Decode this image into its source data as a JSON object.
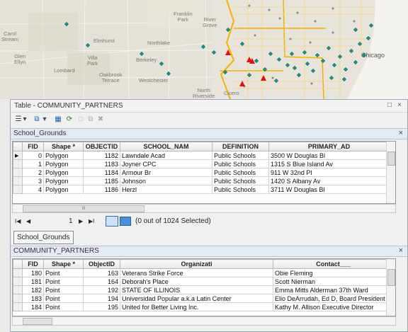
{
  "map": {
    "labels": {
      "franklin_park": "Franklin\nPark",
      "river_grove": "River\nGrove",
      "carol_stream": "Carol\nStream",
      "elmhurst": "Elmhurst",
      "northlake": "Northlake",
      "glen_ellyn": "Glen\nEllyn",
      "villa_park": "Villa\nPark",
      "berkeley": "Berkeley",
      "lombard": "Lombard",
      "oakbrook_terrace": "Oakbrook\nTerrace",
      "westchester": "Westchester",
      "north_riverside": "North\nRiverside",
      "cicero": "Cicero",
      "chicago": "Chicago"
    }
  },
  "window": {
    "title": "Table - COMMUNITY_PARTNERS",
    "restore_glyph": "□",
    "close_glyph": "×"
  },
  "toolbar": {
    "table_options": "☰",
    "dropdown": "▾",
    "related_tables": "⧉",
    "select_by_attributes": "▦",
    "switch_selection": "⟳",
    "clear_selection": "□",
    "zoom_selected": "⧉",
    "delete_selected": "✖"
  },
  "school_grounds": {
    "section_title": "School_Grounds",
    "close_glyph": "×",
    "columns": [
      "FID",
      "Shape *",
      "OBJECTID",
      "SCHOOL_NAM",
      "DEFINITION",
      "PRIMARY_AD"
    ],
    "rows": [
      [
        "0",
        "Polygon",
        "1182",
        "Lawndale Acad",
        "Public Schools",
        "3500 W Douglas Bl"
      ],
      [
        "1",
        "Polygon",
        "1183",
        "Joyner CPC",
        "Public Schools",
        "1315 S Blue Island Av"
      ],
      [
        "2",
        "Polygon",
        "1184",
        "Armour Br",
        "Public Schools",
        "911 W 32nd Pl"
      ],
      [
        "3",
        "Polygon",
        "1185",
        "Johnson",
        "Public Schools",
        "1420 S Albany Av"
      ],
      [
        "4",
        "Polygon",
        "1186",
        "Herzl",
        "Public Schools",
        "3711 W Douglas Bl"
      ]
    ],
    "scroll_grip": "III",
    "current_record": "1",
    "selection_status": "(0 out of 1024 Selected)",
    "tab_label": "School_Grounds"
  },
  "community_partners": {
    "section_title": "COMMUNITY_PARTNERS",
    "close_glyph": "×",
    "columns": [
      "FID",
      "Shape *",
      "ObjectID",
      "Organizati",
      "Contact___"
    ],
    "rows": [
      [
        "180",
        "Point",
        "163",
        "Veterans Strike Force",
        "Obie Fleming"
      ],
      [
        "181",
        "Point",
        "164",
        "Deborah's Place",
        "Scott Nierman"
      ],
      [
        "182",
        "Point",
        "192",
        "STATE OF ILLINOIS",
        "Emma Mitts Alderman 37th Ward"
      ],
      [
        "183",
        "Point",
        "194",
        "Universidad Popular a.k.a Latin Center",
        "Elio DeArrudah, Ed D, Board President"
      ],
      [
        "184",
        "Point",
        "195",
        "United for Better Living Inc.",
        "Kathy M. Allison Executive Director"
      ]
    ]
  },
  "nav": {
    "first": "I◀",
    "prev": "◀",
    "next": "▶",
    "last": "▶I"
  },
  "colors": {
    "map_background": "#e4e1d8",
    "county_boundary": "#f0b400",
    "partner_point": "#1f8f84",
    "school_marker": "#dd1111",
    "header_band": "#e3eaf2"
  }
}
